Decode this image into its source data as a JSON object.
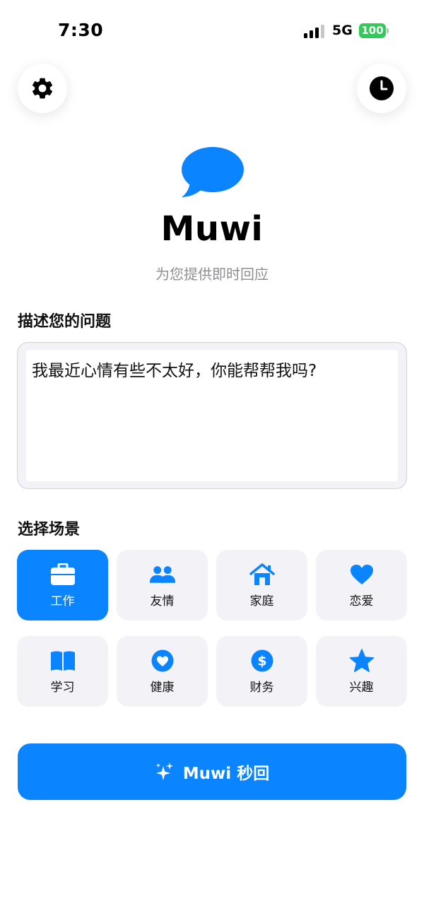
{
  "status": {
    "time": "7:30",
    "network": "5G",
    "battery": "100"
  },
  "header": {
    "settings_icon": "gear-icon",
    "history_icon": "clock-icon"
  },
  "hero": {
    "title": "Muwi",
    "subtitle": "为您提供即时回应",
    "logo_icon": "chat-bubble-icon"
  },
  "question": {
    "label": "描述您的问题",
    "value": "我最近心情有些不太好，你能帮帮我吗?"
  },
  "scenes": {
    "label": "选择场景",
    "items": [
      {
        "label": "工作",
        "icon": "briefcase-icon",
        "selected": true
      },
      {
        "label": "友情",
        "icon": "people-icon",
        "selected": false
      },
      {
        "label": "家庭",
        "icon": "house-icon",
        "selected": false
      },
      {
        "label": "恋爱",
        "icon": "heart-icon",
        "selected": false
      },
      {
        "label": "学习",
        "icon": "book-icon",
        "selected": false
      },
      {
        "label": "健康",
        "icon": "heart-circle-icon",
        "selected": false
      },
      {
        "label": "财务",
        "icon": "dollar-circle-icon",
        "selected": false
      },
      {
        "label": "兴趣",
        "icon": "star-icon",
        "selected": false
      }
    ]
  },
  "action": {
    "label": "Muwi 秒回",
    "icon": "sparkles-icon"
  },
  "colors": {
    "accent": "#0a84ff",
    "tile_bg": "#f2f2f7",
    "battery": "#34c759",
    "subtitle": "#8e8e93"
  }
}
